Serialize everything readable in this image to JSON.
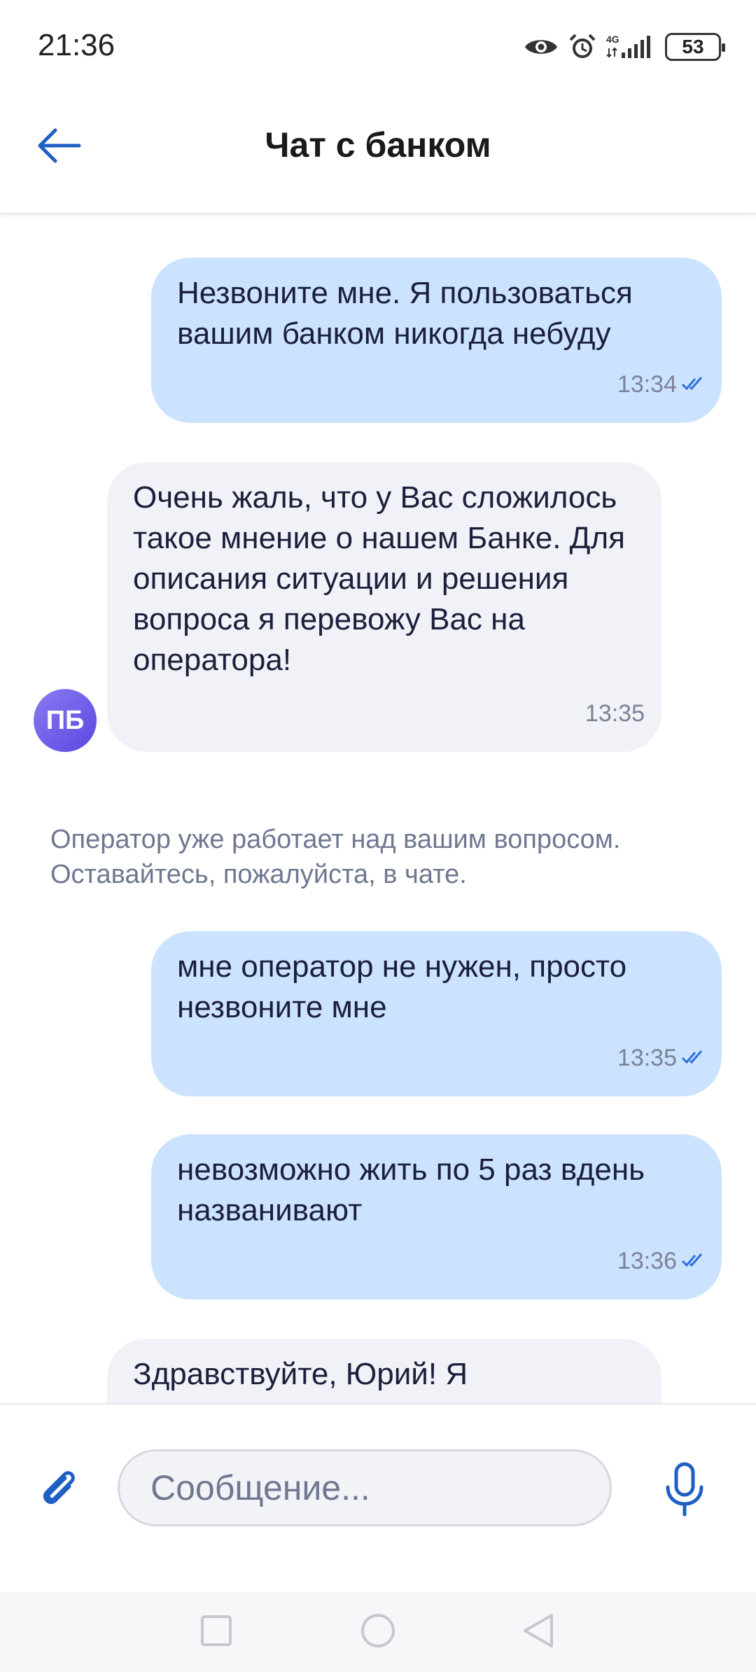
{
  "status_bar": {
    "time": "21:36",
    "network": "4G",
    "battery": "53",
    "icons": [
      "eye-icon",
      "alarm-icon",
      "signal-icon",
      "battery-icon"
    ]
  },
  "header": {
    "title": "Чат с банком",
    "back_icon": "arrow-left-icon"
  },
  "messages": [
    {
      "direction": "outgoing",
      "text": "Незвоните мне. Я пользоваться вашим банком никогда небуду",
      "time": "13:34",
      "status": "read"
    },
    {
      "direction": "incoming",
      "avatar": "ПБ",
      "text": "Очень жаль, что у Вас сложилось такое мнение о нашем Банке. Для описания ситуации и решения вопроса я перевожу Вас на оператора!",
      "time": "13:35"
    },
    {
      "direction": "outgoing",
      "text": "мне оператор не нужен, просто незвоните мне",
      "time": "13:35",
      "status": "read"
    },
    {
      "direction": "outgoing",
      "text": "невозможно жить по 5 раз вдень названивают",
      "time": "13:36",
      "status": "read"
    },
    {
      "direction": "incoming",
      "text": "Здравствуйте, Юрий! Я"
    }
  ],
  "system_note": "Оператор уже работает над вашим вопросом.\nОставайтесь, пожалуйста, в чате.",
  "composer": {
    "placeholder": "Сообщение...",
    "attach_icon": "paperclip-icon",
    "mic_icon": "microphone-icon"
  },
  "nav_bar": {
    "icons": [
      "recents-square-icon",
      "home-circle-icon",
      "back-triangle-icon"
    ]
  },
  "colors": {
    "accent": "#1f5fc4",
    "outgoing_bubble": "#cce3ff",
    "incoming_bubble": "#f1f2f7",
    "avatar": "#6b5ce7",
    "read_ticks": "#2f6fdb"
  }
}
